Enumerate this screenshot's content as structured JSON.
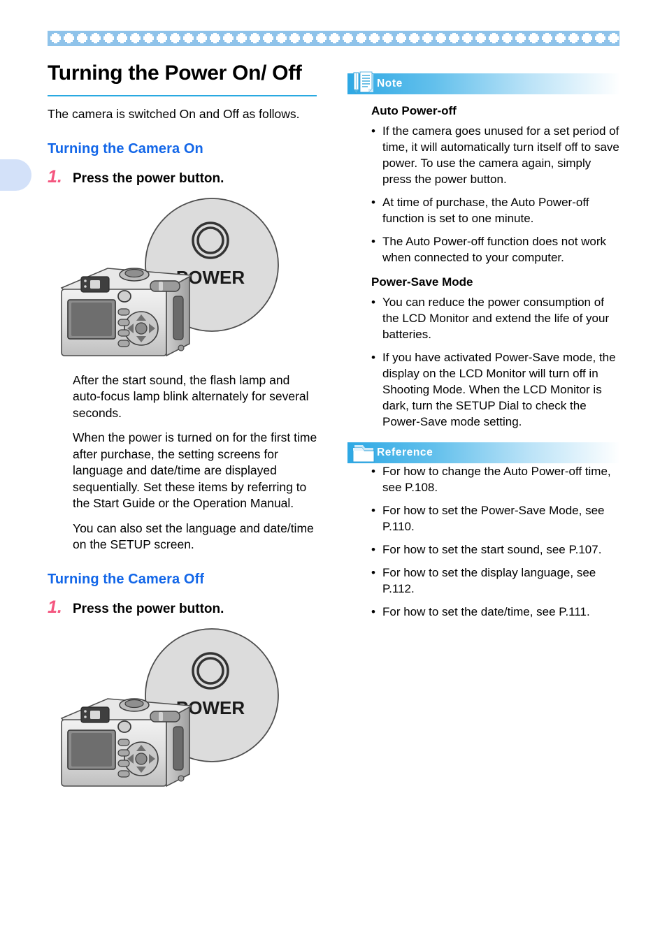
{
  "page": {
    "title": "Turning the Power On/ Off",
    "intro": "The camera is switched On and Off as follows."
  },
  "decor": {
    "band_color": "#8fc3ea",
    "motif_color": "#ffffff",
    "motif_count": 43,
    "tab_color": "#d3e1f9",
    "rule_color": "#29a9e1",
    "subhead_color": "#1266e8",
    "step_number_color": "#f4567f"
  },
  "sections": [
    {
      "heading": "Turning the Camera On",
      "step_number": "1.",
      "step_text": "Press the power button.",
      "figure": {
        "callout_label": "POWER",
        "icon": "power-ring-icon",
        "alt": "camera-back-view-illustration"
      },
      "paragraphs": [
        "After the start sound, the flash lamp and auto-focus lamp blink alternately for several seconds.",
        "When the power is turned on for the first time after purchase, the setting screens for language and date/time are displayed sequentially. Set these items by referring to the Start Guide or the Operation Manual.",
        "You can also set the language and date/time on the SETUP screen."
      ]
    },
    {
      "heading": "Turning the Camera Off",
      "step_number": "1.",
      "step_text": "Press the power button.",
      "figure": {
        "callout_label": "POWER",
        "icon": "power-ring-icon",
        "alt": "camera-back-view-illustration"
      },
      "paragraphs": []
    }
  ],
  "note": {
    "banner_label": "Note",
    "banner_icon": "note-pencil-paper-icon",
    "groups": [
      {
        "title": "Auto Power-off",
        "items": [
          "If the camera goes unused for a set period of time, it will automatically turn itself off to save power. To use the camera again, simply press the power button.",
          "At time of purchase, the Auto Power-off function is set to one minute.",
          "The Auto Power-off function does not work when connected to your computer."
        ]
      },
      {
        "title": "Power-Save Mode",
        "items": [
          "You can reduce the power consumption of the LCD Monitor and extend the life of your batteries.",
          "If you have activated Power-Save mode, the display on the LCD Monitor will turn off in Shooting Mode. When the LCD Monitor is dark, turn the SETUP Dial to check the Power-Save mode setting."
        ]
      }
    ]
  },
  "reference": {
    "banner_label": "Reference",
    "banner_icon": "folder-icon",
    "items": [
      "For how to change the Auto Power-off time, see P.108.",
      "For how to set the Power-Save Mode, see P.110.",
      "For how to set the start sound, see P.107.",
      "For how to set the display language, see P.112.",
      "For how to set the date/time, see P.111."
    ]
  }
}
